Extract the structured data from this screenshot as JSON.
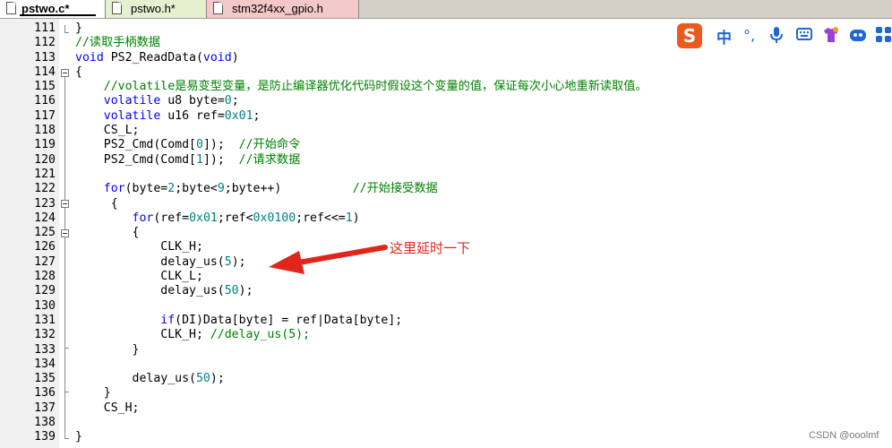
{
  "tabs": [
    {
      "label": "pstwo.c*",
      "active": true
    },
    {
      "label": "pstwo.h*",
      "active": false
    },
    {
      "label": "stm32f4xx_gpio.h",
      "active": false
    }
  ],
  "code_lines": [
    {
      "num": "111",
      "html": "}"
    },
    {
      "num": "112",
      "html": "<span class=\"cm\">//读取手柄数据</span>"
    },
    {
      "num": "113",
      "html": "<span class=\"kw\">void</span> PS2_ReadData(<span class=\"kw\">void</span>)"
    },
    {
      "num": "114",
      "html": "{"
    },
    {
      "num": "115",
      "html": "    <span class=\"cm\">//volatile是易变型变量，是防止编译器优化代码时假设这个变量的值，保证每次小心地重新读取值。</span>"
    },
    {
      "num": "116",
      "html": "    <span class=\"kw\">volatile</span> u8 byte=<span class=\"num\">0</span>;"
    },
    {
      "num": "117",
      "html": "    <span class=\"kw\">volatile</span> u16 ref=<span class=\"num\">0x01</span>;"
    },
    {
      "num": "118",
      "html": "    CS_L;"
    },
    {
      "num": "119",
      "html": "    PS2_Cmd(Comd[<span class=\"num\">0</span>]);  <span class=\"cm\">//开始命令</span>"
    },
    {
      "num": "120",
      "html": "    PS2_Cmd(Comd[<span class=\"num\">1</span>]);  <span class=\"cm\">//请求数据</span>"
    },
    {
      "num": "121",
      "html": ""
    },
    {
      "num": "122",
      "html": "    <span class=\"kw\">for</span>(byte=<span class=\"num\">2</span>;byte&lt;<span class=\"num\">9</span>;byte++)          <span class=\"cm\">//开始接受数据</span>"
    },
    {
      "num": "123",
      "html": "     {"
    },
    {
      "num": "124",
      "html": "        <span class=\"kw\">for</span>(ref=<span class=\"num\">0x01</span>;ref&lt;<span class=\"num\">0x0100</span>;ref&lt;&lt;=<span class=\"num\">1</span>)"
    },
    {
      "num": "125",
      "html": "        {"
    },
    {
      "num": "126",
      "html": "            CLK_H;"
    },
    {
      "num": "127",
      "html": "            delay_us(<span class=\"num\">5</span>);"
    },
    {
      "num": "128",
      "html": "            CLK_L;"
    },
    {
      "num": "129",
      "html": "            delay_us(<span class=\"num\">50</span>);"
    },
    {
      "num": "130",
      "html": ""
    },
    {
      "num": "131",
      "html": "            <span class=\"kw\">if</span>(DI)Data[byte] = ref|Data[byte];"
    },
    {
      "num": "132",
      "html": "            CLK_H; <span class=\"cm\">//delay_us(5);</span>"
    },
    {
      "num": "133",
      "html": "        }"
    },
    {
      "num": "134",
      "html": ""
    },
    {
      "num": "135",
      "html": "        delay_us(<span class=\"num\">50</span>);"
    },
    {
      "num": "136",
      "html": "    }"
    },
    {
      "num": "137",
      "html": "    CS_H;"
    },
    {
      "num": "138",
      "html": ""
    },
    {
      "num": "139",
      "html": "}"
    }
  ],
  "annotation": {
    "text": "这里延时一下",
    "color": "#e0261a"
  },
  "ime_toolbar": {
    "logo": "S",
    "mode": "中",
    "icons": [
      "punctuation-icon",
      "microphone-icon",
      "keyboard-icon",
      "skin-icon",
      "emoji-icon",
      "apps-grid-icon"
    ]
  },
  "watermark": "CSDN @ooolmf",
  "colors": {
    "keyword": "#0000ff",
    "comment": "#008000",
    "number": "#008080",
    "annotation": "#e0261a"
  }
}
